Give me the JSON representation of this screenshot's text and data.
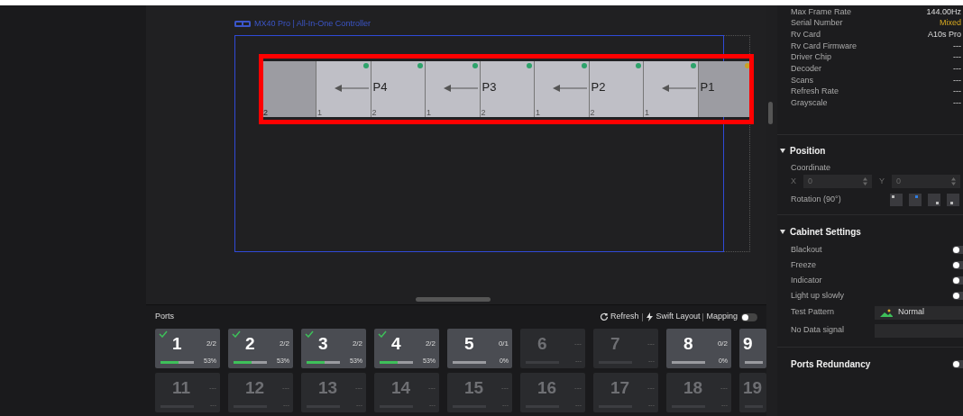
{
  "canvas": {
    "controller_title": "MX40 Pro | All-In-One Controller",
    "cabinets": [
      {
        "kind": "blank",
        "index": "2"
      },
      {
        "kind": "panel",
        "index": "1",
        "color": "#2ea36b",
        "arrow": true
      },
      {
        "kind": "panel",
        "index": "2",
        "color": "#2ea36b",
        "port": "P4"
      },
      {
        "kind": "panel",
        "index": "1",
        "color": "#2ea36b",
        "arrow": true
      },
      {
        "kind": "panel",
        "index": "2",
        "color": "#2ea36b",
        "port": "P3"
      },
      {
        "kind": "panel",
        "index": "1",
        "color": "#2ea36b",
        "arrow": true
      },
      {
        "kind": "panel",
        "index": "2",
        "color": "#2ea36b",
        "port": "P2"
      },
      {
        "kind": "panel",
        "index": "1",
        "color": "#2ea36b",
        "arrow": true
      },
      {
        "kind": "blank",
        "color": "#c9a227",
        "port": "P1"
      }
    ]
  },
  "ports": {
    "title": "Ports",
    "refresh": "Refresh",
    "swift_layout": "Swift Layout",
    "mapping": "Mapping",
    "mapping_on": false,
    "tiles": [
      {
        "number": "1",
        "count": "2/2",
        "percent": "53%",
        "checked": true,
        "active": true,
        "level": 0.53
      },
      {
        "number": "2",
        "count": "2/2",
        "percent": "53%",
        "checked": true,
        "active": true,
        "level": 0.53
      },
      {
        "number": "3",
        "count": "2/2",
        "percent": "53%",
        "checked": true,
        "active": true,
        "level": 0.53
      },
      {
        "number": "4",
        "count": "2/2",
        "percent": "53%",
        "checked": true,
        "active": true,
        "level": 0.53
      },
      {
        "number": "5",
        "count": "0/1",
        "percent": "0%",
        "checked": false,
        "active": true,
        "level": 0
      },
      {
        "number": "6",
        "count": "---",
        "percent": "---",
        "checked": false,
        "active": false,
        "level": 0
      },
      {
        "number": "7",
        "count": "---",
        "percent": "---",
        "checked": false,
        "active": false,
        "level": 0
      },
      {
        "number": "8",
        "count": "0/2",
        "percent": "0%",
        "checked": false,
        "active": true,
        "level": 0
      },
      {
        "number": "9",
        "checked": false,
        "active": true,
        "level": 0
      },
      {
        "number": "11",
        "count": "---",
        "percent": "---",
        "checked": false,
        "active": false,
        "level": 0
      },
      {
        "number": "12",
        "count": "---",
        "percent": "---",
        "checked": false,
        "active": false,
        "level": 0
      },
      {
        "number": "13",
        "count": "---",
        "percent": "---",
        "checked": false,
        "active": false,
        "level": 0
      },
      {
        "number": "14",
        "count": "---",
        "percent": "---",
        "checked": false,
        "active": false,
        "level": 0
      },
      {
        "number": "15",
        "count": "---",
        "percent": "---",
        "checked": false,
        "active": false,
        "level": 0
      },
      {
        "number": "16",
        "count": "---",
        "percent": "---",
        "checked": false,
        "active": false,
        "level": 0
      },
      {
        "number": "17",
        "count": "---",
        "percent": "---",
        "checked": false,
        "active": false,
        "level": 0
      },
      {
        "number": "18",
        "count": "---",
        "percent": "---",
        "checked": false,
        "active": false,
        "level": 0
      },
      {
        "number": "19",
        "checked": false,
        "active": false,
        "level": 0
      }
    ]
  },
  "properties": {
    "rows": [
      {
        "label": "Max Frame Rate",
        "value": "144.00Hz",
        "kind": "normal"
      },
      {
        "label": "Serial Number",
        "value": "Mixed",
        "kind": "warn"
      },
      {
        "label": "Rv Card",
        "value": "A10s Pro",
        "kind": "normal"
      },
      {
        "label": "Rv Card Firmware",
        "value": "---",
        "kind": "normal"
      },
      {
        "label": "Driver Chip",
        "value": "---",
        "kind": "normal"
      },
      {
        "label": "Decoder",
        "value": "---",
        "kind": "normal"
      },
      {
        "label": "Scans",
        "value": "---",
        "kind": "normal"
      },
      {
        "label": "Refresh Rate",
        "value": "---",
        "kind": "normal"
      },
      {
        "label": "Grayscale",
        "value": "---",
        "kind": "normal"
      }
    ]
  },
  "position": {
    "title": "Position",
    "coordinate_label": "Coordinate",
    "x_label": "X",
    "x_value": "0",
    "y_label": "Y",
    "y_value": "0",
    "rotation_label": "Rotation (90°)",
    "rotations": [
      {
        "selected": false
      },
      {
        "selected": true
      },
      {
        "selected": false
      },
      {
        "selected": false
      }
    ]
  },
  "cabinet_settings": {
    "title": "Cabinet Settings",
    "toggles": [
      {
        "label": "Blackout",
        "on": false
      },
      {
        "label": "Freeze",
        "on": false
      },
      {
        "label": "Indicator",
        "on": false
      },
      {
        "label": "Light up slowly",
        "on": false
      }
    ],
    "test_pattern_label": "Test Pattern",
    "test_pattern_value": "Normal",
    "no_data_label": "No Data signal"
  },
  "ports_redundancy": {
    "label": "Ports Redundancy",
    "on": false
  }
}
